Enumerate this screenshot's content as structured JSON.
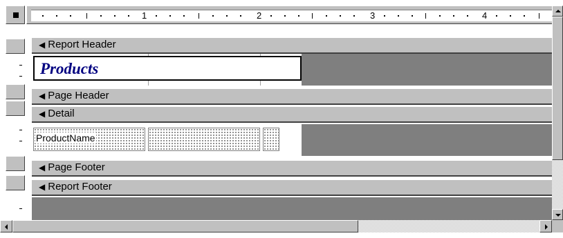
{
  "ruler": {
    "labels": [
      "1",
      "2",
      "3",
      "4"
    ]
  },
  "sections": {
    "report_header": "Report Header",
    "page_header": "Page Header",
    "detail": "Detail",
    "page_footer": "Page Footer",
    "report_footer": "Report Footer"
  },
  "controls": {
    "title_label": "Products",
    "product_name_field": "ProductName"
  },
  "icons": {
    "section_marker": "section-expand-arrow-icon",
    "scroll_up": "scroll-up-arrow-icon",
    "scroll_down": "scroll-down-arrow-icon",
    "scroll_left": "scroll-left-arrow-icon",
    "scroll_right": "scroll-right-arrow-icon"
  },
  "colors": {
    "title_text": "#000080",
    "section_bar": "#c0c0c0",
    "unused_area": "#7f7f7f"
  }
}
